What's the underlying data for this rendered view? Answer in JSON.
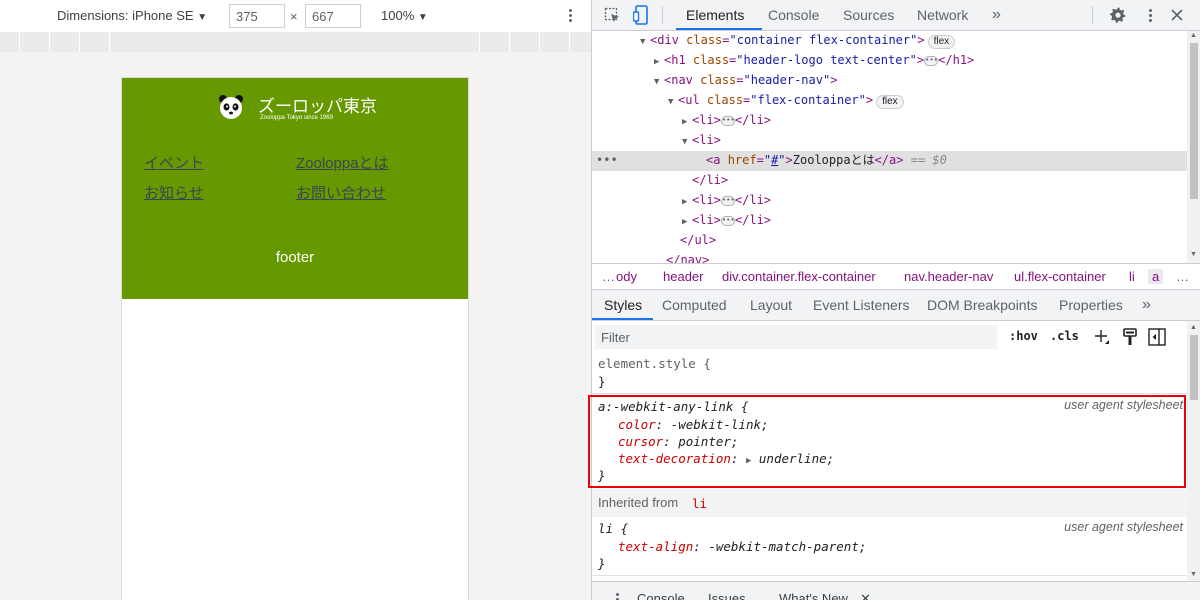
{
  "device_toolbar": {
    "dimensions_label": "Dimensions: iPhone SE",
    "width_value": "375",
    "times": "×",
    "height_value": "667",
    "zoom_label": "100%"
  },
  "site": {
    "logo_title": "ズーロッパ東京",
    "logo_subtitle": "Zooloppa Tokyo since 1969",
    "nav": [
      "イベント",
      "Zooloppaとは",
      "お知らせ",
      "お問い合わせ"
    ],
    "footer": "footer",
    "header_color": "#669900"
  },
  "devtools": {
    "tabs": [
      "Elements",
      "Console",
      "Sources",
      "Network"
    ],
    "active_tab": "Elements",
    "more_tabs": "»",
    "dom": {
      "l1_tag_open": "<div",
      "l1_attr": "class",
      "l1_val": "\"container flex-container\"",
      "l1_badge": "flex",
      "l2_tag_open": "<h1",
      "l2_attr": "class",
      "l2_val": "\"header-logo text-center\"",
      "l2_tag_close": "</h1>",
      "l3_tag_open": "<nav",
      "l3_attr": "class",
      "l3_val": "\"header-nav\"",
      "l4_tag_open": "<ul",
      "l4_attr": "class",
      "l4_val": "\"flex-container\"",
      "l4_badge": "flex",
      "li_open": "<li>",
      "li_close": "</li>",
      "a_open": "<a",
      "a_attr": "href",
      "a_val": "#",
      "a_text": "Zooloppaとは",
      "a_close": "</a>",
      "eq_sel": "== $0",
      "ul_close": "</ul>",
      "nav_close": "</nav>",
      "gt": ">",
      "eq": "=",
      "quote": "\""
    },
    "breadcrumbs": [
      "ody",
      "header",
      "div.container.flex-container",
      "nav.header-nav",
      "ul.flex-container",
      "li",
      "a"
    ],
    "breadcrumb_more": "…",
    "subtabs": [
      "Styles",
      "Computed",
      "Layout",
      "Event Listeners",
      "DOM Breakpoints",
      "Properties"
    ],
    "subtabs_more": "»",
    "filter_placeholder": "Filter",
    "hov": ":hov",
    "cls": ".cls",
    "styles": {
      "element_style": "element.style {",
      "close_brace": "}",
      "rule1_selector": "a:-webkit-any-link {",
      "rule1_source": "user agent stylesheet",
      "rule1_props": [
        {
          "name": "color",
          "value": "-webkit-link;"
        },
        {
          "name": "cursor",
          "value": "pointer;"
        },
        {
          "name": "text-decoration",
          "value": "underline;"
        }
      ],
      "inherited_label": "Inherited from",
      "inherited_tag": "li",
      "rule2_selector": "li {",
      "rule2_source": "user agent stylesheet",
      "rule2_props": [
        {
          "name": "text-align",
          "value": "-webkit-match-parent;"
        }
      ]
    },
    "drawer_tabs": [
      "Console",
      "Issues",
      "What's New"
    ],
    "highlight_color": "#e8000b",
    "accent_color": "#1a73e8"
  }
}
